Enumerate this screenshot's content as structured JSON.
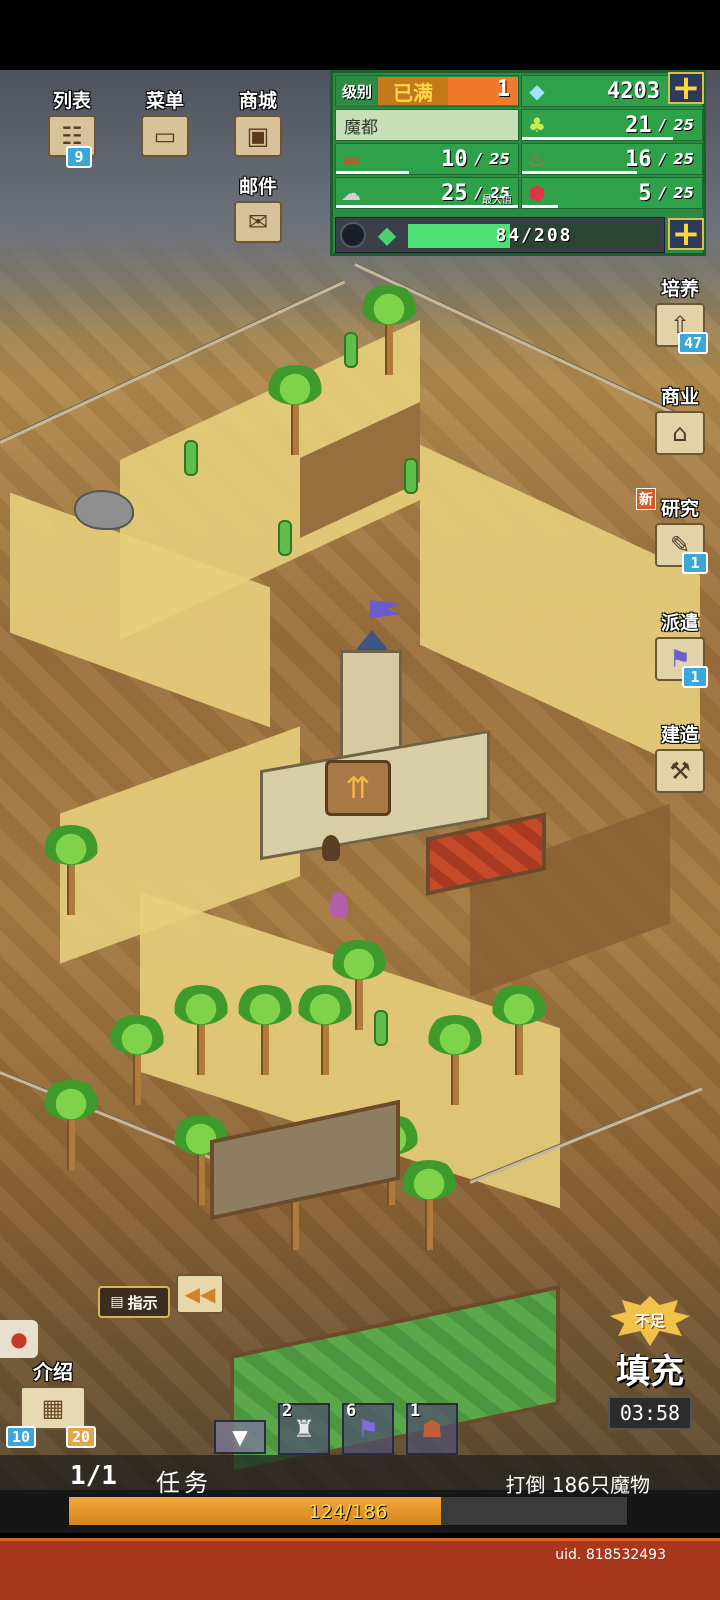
{
  "top_menu": {
    "list": {
      "label": "列表",
      "badge": "9",
      "icon": "list-scroll-icon"
    },
    "menu": {
      "label": "菜单",
      "icon": "menu-board-icon"
    },
    "shop": {
      "label": "商城",
      "icon": "shop-chest-icon"
    },
    "mail": {
      "label": "邮件",
      "icon": "mail-envelope-icon"
    }
  },
  "status": {
    "level_label": "级别",
    "level_value": "已满",
    "level_num": "1",
    "gems": "4203",
    "town_name": "魔都",
    "grass": {
      "cur": "21",
      "max": "25"
    },
    "wood": {
      "cur": "10",
      "max": "25"
    },
    "meat": {
      "cur": "16",
      "max": "25"
    },
    "ore": {
      "cur": "25",
      "max": "25",
      "note": "最大值"
    },
    "crystal": {
      "cur": "5",
      "max": "25"
    },
    "slash": "/",
    "exp": "84/208",
    "exp_fraction": 0.404
  },
  "side_menu": {
    "train": {
      "label": "培养",
      "badge": "47"
    },
    "business": {
      "label": "商业"
    },
    "research": {
      "label": "研究",
      "new": "新",
      "badge": "1"
    },
    "dispatch": {
      "label": "派遣",
      "badge": "1"
    },
    "build": {
      "label": "建造"
    }
  },
  "map_labels": {
    "guide": "指示",
    "intro": "介绍",
    "intro_badge_left": "10",
    "intro_badge_right": "20",
    "refill_top": "不足",
    "refill": "填充",
    "timer": "03:58"
  },
  "slots": [
    {
      "count": "2",
      "icon": "tower-icon"
    },
    {
      "count": "6",
      "icon": "flag-icon"
    },
    {
      "count": "1",
      "icon": "cave-icon"
    }
  ],
  "quest": {
    "counter": "1/1",
    "title": "任务",
    "desc": "打倒 186只魔物",
    "progress_text": "124/186",
    "progress_fraction": 0.667
  },
  "footer": {
    "uid": "uid. 818532493"
  }
}
